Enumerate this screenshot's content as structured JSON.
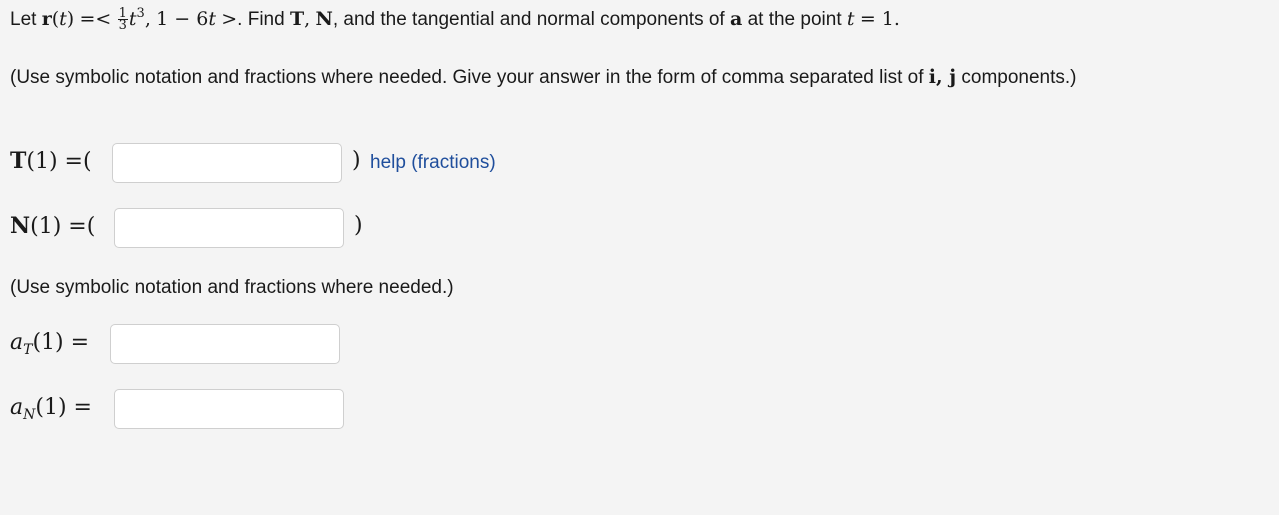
{
  "problem": {
    "lead": "Let",
    "r_vec": "r",
    "t_var": "t",
    "eq_open": "=<",
    "frac_num": "1",
    "frac_den": "3",
    "comp1_power": "3",
    "comp_sep": ",",
    "comp2": "1 − 6",
    "close": ">",
    "find_text": ". Find",
    "T_vec": "T",
    "N_vec": "N",
    "rest_text": ", and the tangential and normal components of",
    "a_vec": "a",
    "at_point_text": "at the point",
    "point_value": "= 1."
  },
  "instructions": {
    "part1": "(Use symbolic notation and fractions where needed. Give your answer in the form of comma separated list of",
    "ij": "i, j",
    "part2": "components.)",
    "second": "(Use symbolic notation and fractions where needed.)"
  },
  "fields": {
    "T_label_vec": "T",
    "T_label_arg": "(1) =(",
    "T_close": ")",
    "T_value": "",
    "N_label_vec": "N",
    "N_label_arg": "(1) =(",
    "N_close": ")",
    "N_value": "",
    "aT_base": "a",
    "aT_sub": "T",
    "aT_arg": "(1) =",
    "aT_value": "",
    "aN_base": "a",
    "aN_sub": "N",
    "aN_arg": "(1) =",
    "aN_value": ""
  },
  "help": {
    "label": "help (fractions)"
  }
}
